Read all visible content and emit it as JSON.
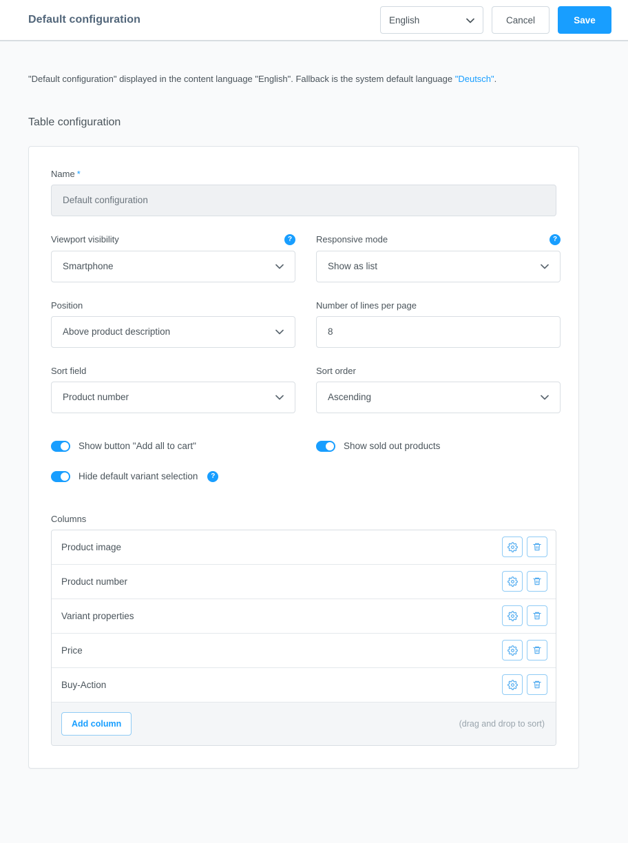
{
  "topbar": {
    "title": "Default configuration",
    "language_value": "English",
    "cancel_label": "Cancel",
    "save_label": "Save",
    "chevron_icon": "chevron-down-icon"
  },
  "notice": {
    "prefix": "\"Default configuration\" displayed in the content language \"English\". Fallback is the system default language ",
    "link": "\"Deutsch\"",
    "suffix": "."
  },
  "section": {
    "title": "Table configuration"
  },
  "fields": {
    "name": {
      "label": "Name",
      "required_marker": "*",
      "value": "Default configuration"
    },
    "viewport_visibility": {
      "label": "Viewport visibility",
      "value": "Smartphone",
      "help": "?"
    },
    "responsive_mode": {
      "label": "Responsive mode",
      "value": "Show as list",
      "help": "?"
    },
    "position": {
      "label": "Position",
      "value": "Above product description"
    },
    "lines_per_page": {
      "label": "Number of lines per page",
      "value": "8"
    },
    "sort_field": {
      "label": "Sort field",
      "value": "Product number"
    },
    "sort_order": {
      "label": "Sort order",
      "value": "Ascending"
    }
  },
  "toggles": [
    {
      "label": "Show button \"Add all to cart\"",
      "on": true,
      "help": null
    },
    {
      "label": "Show sold out products",
      "on": true,
      "help": null
    },
    {
      "label": "Hide default variant selection",
      "on": true,
      "help": "?"
    }
  ],
  "columns": {
    "label": "Columns",
    "rows": [
      {
        "name": "Product image"
      },
      {
        "name": "Product number"
      },
      {
        "name": "Variant properties"
      },
      {
        "name": "Price"
      },
      {
        "name": "Buy-Action"
      }
    ],
    "add_label": "Add column",
    "drag_hint": "(drag and drop to sort)",
    "settings_icon": "gear-icon",
    "delete_icon": "trash-icon"
  },
  "colors": {
    "accent": "#189eff",
    "page_bg": "#f9fafb",
    "text": "#4a545b"
  }
}
